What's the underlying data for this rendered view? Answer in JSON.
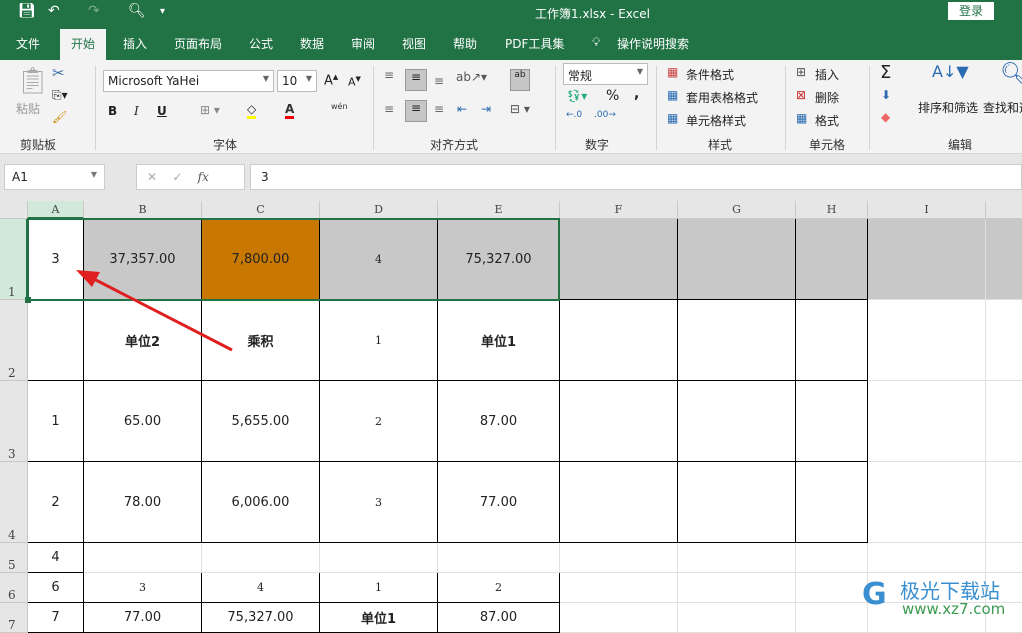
{
  "titlebar": {
    "title": "工作簿1.xlsx  -  Excel",
    "login": "登录"
  },
  "tabs": [
    "文件",
    "开始",
    "插入",
    "页面布局",
    "公式",
    "数据",
    "审阅",
    "视图",
    "帮助",
    "PDF工具集"
  ],
  "active_tab": "开始",
  "tell_me": "操作说明搜索",
  "ribbon": {
    "paste": "粘贴",
    "clipboard": "剪贴板",
    "font_name": "Microsoft YaHei",
    "font_size": "10",
    "font": "字体",
    "bold": "B",
    "italic": "I",
    "underline": "U",
    "phonetic": "wén",
    "alignment": "对齐方式",
    "number_format": "常规",
    "number": "数字",
    "percent": "%",
    "comma": ",",
    "cond_format": "条件格式",
    "table_format": "套用表格格式",
    "cell_style": "单元格样式",
    "styles": "样式",
    "insert": "插入",
    "delete": "删除",
    "format": "格式",
    "cells": "单元格",
    "sort_filter": "排序和筛选",
    "find_select": "查找和选择",
    "editing": "编辑",
    "colors": {
      "highlight": "#ffff00",
      "font_color": "#ff0000"
    }
  },
  "formula_bar": {
    "name_box": "A1",
    "fx": "fx",
    "value": "3"
  },
  "sheet": {
    "columns": [
      "A",
      "B",
      "C",
      "D",
      "E",
      "F",
      "G",
      "H",
      "I"
    ],
    "rows": [
      "1",
      "2",
      "3",
      "4",
      "5",
      "6",
      "7"
    ],
    "cells": [
      [
        "3",
        "37,357.00",
        "7,800.00",
        "4",
        "75,327.00",
        "",
        "",
        "",
        ""
      ],
      [
        "",
        "单位2",
        "乘积",
        "1",
        "单位1",
        "",
        "",
        "",
        ""
      ],
      [
        "1",
        "65.00",
        "5,655.00",
        "2",
        "87.00",
        "",
        "",
        "",
        ""
      ],
      [
        "2",
        "78.00",
        "6,006.00",
        "3",
        "77.00",
        "",
        "",
        "",
        ""
      ],
      [
        "4",
        "",
        "",
        "",
        "",
        "",
        "",
        "",
        ""
      ],
      [
        "6",
        "3",
        "4",
        "1",
        "2",
        "",
        "",
        "",
        ""
      ],
      [
        "7",
        "77.00",
        "75,327.00",
        "单位1",
        "87.00",
        "",
        "",
        "",
        ""
      ]
    ],
    "selected": "A1",
    "colors": {
      "gray_fill": "#c8c8c8",
      "orange_fill": "#c87800",
      "accent": "#217346"
    }
  },
  "watermark": {
    "name": "极光下载站",
    "url": "www.xz7.com"
  }
}
